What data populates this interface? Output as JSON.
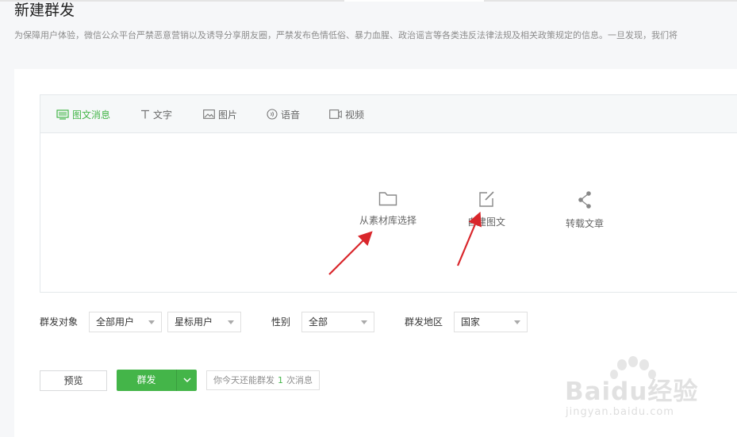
{
  "page": {
    "title": "新建群发",
    "notice": "为保障用户体验，微信公众平台严禁恶意营销以及诱导分享朋友圈，严禁发布色情低俗、暴力血腥、政治谣言等各类违反法律法规及相关政策规定的信息。一旦发现，我们将"
  },
  "tabs": [
    {
      "label": "图文消息",
      "icon": "article-icon",
      "active": true
    },
    {
      "label": "文字",
      "icon": "text-icon",
      "active": false
    },
    {
      "label": "图片",
      "icon": "image-icon",
      "active": false
    },
    {
      "label": "语音",
      "icon": "voice-icon",
      "active": false
    },
    {
      "label": "视频",
      "icon": "video-icon",
      "active": false
    }
  ],
  "actions": [
    {
      "label": "从素材库选择",
      "icon": "folder-icon"
    },
    {
      "label": "自建图文",
      "icon": "edit-icon"
    },
    {
      "label": "转载文章",
      "icon": "share-icon"
    }
  ],
  "filters": {
    "target_label": "群发对象",
    "target_value": "全部用户",
    "tag_value": "星标用户",
    "gender_label": "性别",
    "gender_value": "全部",
    "region_label": "群发地区",
    "region_value": "国家"
  },
  "footer": {
    "preview_label": "预览",
    "send_label": "群发",
    "quota_prefix": "你今天还能群发",
    "quota_count": "1",
    "quota_suffix": "次消息"
  },
  "watermark": {
    "text": "Baidu经验",
    "sub": "jingyan.baidu.com"
  },
  "colors": {
    "accent": "#44b549",
    "annotation_arrow": "#d9262b"
  }
}
